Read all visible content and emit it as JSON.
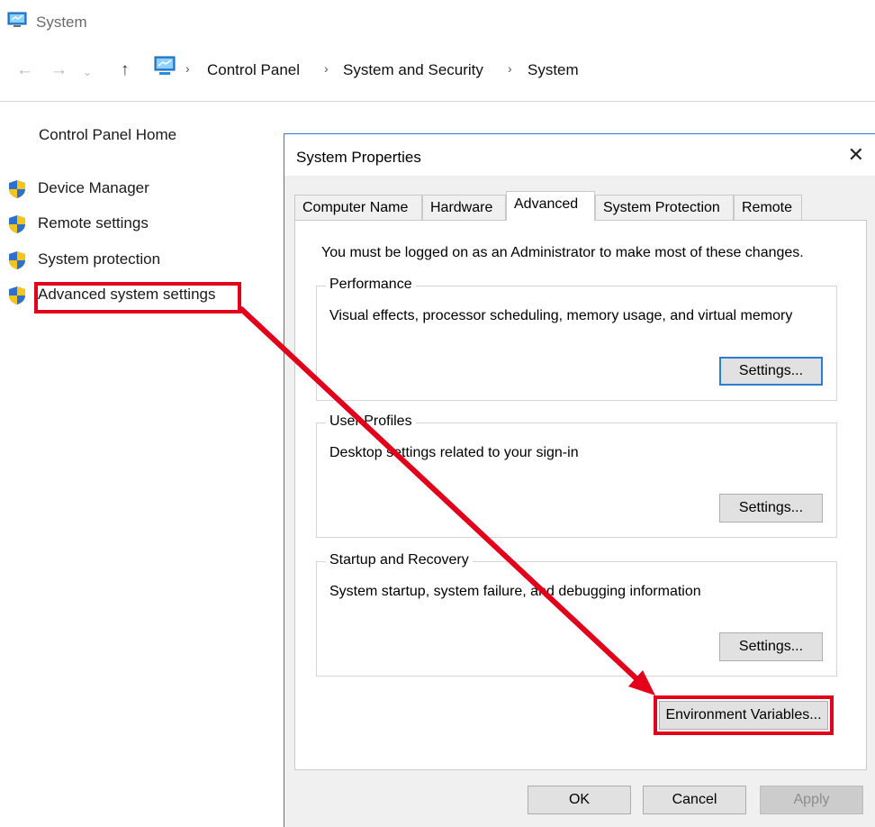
{
  "window": {
    "title": "System"
  },
  "address": {
    "crumbs": [
      "Control Panel",
      "System and Security",
      "System"
    ]
  },
  "sidebar": {
    "home": "Control Panel Home",
    "items": [
      {
        "label": "Device Manager",
        "icon": "uac-shield-icon"
      },
      {
        "label": "Remote settings",
        "icon": "uac-shield-icon"
      },
      {
        "label": "System protection",
        "icon": "uac-shield-icon"
      },
      {
        "label": "Advanced system settings",
        "icon": "uac-shield-icon",
        "highlighted": true
      }
    ]
  },
  "dialog": {
    "title": "System Properties",
    "close": "✕",
    "tabs": [
      "Computer Name",
      "Hardware",
      "Advanced",
      "System Protection",
      "Remote"
    ],
    "active_tab": "Advanced",
    "notice": "You must be logged on as an Administrator to make most of these changes.",
    "groups": [
      {
        "title": "Performance",
        "desc": "Visual effects, processor scheduling, memory usage, and virtual memory",
        "button": "Settings..."
      },
      {
        "title": "User Profiles",
        "desc": "Desktop settings related to your sign-in",
        "button": "Settings..."
      },
      {
        "title": "Startup and Recovery",
        "desc": "System startup, system failure, and debugging information",
        "button": "Settings..."
      }
    ],
    "env_button": "Environment Variables...",
    "ok": "OK",
    "cancel": "Cancel",
    "apply": "Apply"
  },
  "colors": {
    "highlight": "#e3001b",
    "accent": "#2d7dd6"
  }
}
